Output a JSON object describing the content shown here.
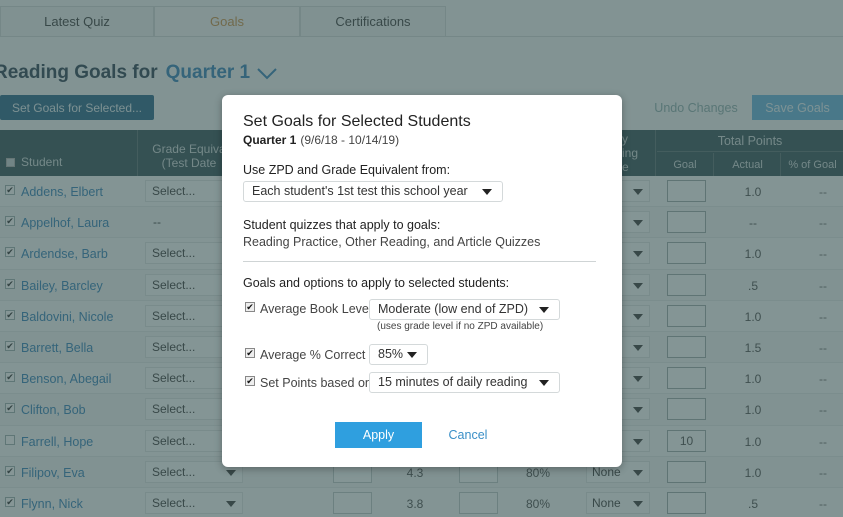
{
  "tabs": [
    {
      "label": "Latest Quiz",
      "active": false
    },
    {
      "label": "Goals",
      "active": true
    },
    {
      "label": "Certifications",
      "active": false
    }
  ],
  "header": {
    "title": "Reading Goals for",
    "period": "Quarter 1",
    "period_icon": "chevron-down-icon"
  },
  "toolbar": {
    "set_goals_label": "Set Goals for Selected...",
    "undo_label": "Undo Changes",
    "save_label": "Save Goals"
  },
  "table": {
    "headers": {
      "student": "Student",
      "grade_line1": "Grade Equiva",
      "grade_line2": "(Test Date",
      "reading_line1": "y",
      "reading_line2": "ing",
      "reading_line3": "e",
      "total_points": "Total Points",
      "goal": "Goal",
      "actual": "Actual",
      "pct_goal": "% of Goal"
    },
    "rows": [
      {
        "checked": true,
        "name": "Addens, Elbert",
        "grade": "Select...",
        "grade_is_select": true,
        "book_level": "",
        "pct_correct": "",
        "reading": "",
        "goal": "",
        "actual": "1.0",
        "pct_goal": "--"
      },
      {
        "checked": true,
        "name": "Appelhof, Laura",
        "grade": "--",
        "grade_is_select": false,
        "book_level": "",
        "pct_correct": "",
        "reading": "",
        "goal": "",
        "actual": "--",
        "pct_goal": "--"
      },
      {
        "checked": true,
        "name": "Ardendse, Barb",
        "grade": "Select...",
        "grade_is_select": true,
        "book_level": "",
        "pct_correct": "",
        "reading": "",
        "goal": "",
        "actual": "1.0",
        "pct_goal": "--"
      },
      {
        "checked": true,
        "name": "Bailey, Barcley",
        "grade": "Select...",
        "grade_is_select": true,
        "book_level": "",
        "pct_correct": "",
        "reading": "",
        "goal": "",
        "actual": ".5",
        "pct_goal": "--"
      },
      {
        "checked": true,
        "name": "Baldovini, Nicole",
        "grade": "Select...",
        "grade_is_select": true,
        "book_level": "",
        "pct_correct": "",
        "reading": "",
        "goal": "",
        "actual": "1.0",
        "pct_goal": "--"
      },
      {
        "checked": true,
        "name": "Barrett, Bella",
        "grade": "Select...",
        "grade_is_select": true,
        "book_level": "",
        "pct_correct": "",
        "reading": "",
        "goal": "",
        "actual": "1.5",
        "pct_goal": "--"
      },
      {
        "checked": true,
        "name": "Benson, Abegail",
        "grade": "Select...",
        "grade_is_select": true,
        "book_level": "",
        "pct_correct": "",
        "reading": "",
        "goal": "",
        "actual": "1.0",
        "pct_goal": "--"
      },
      {
        "checked": true,
        "name": "Clifton, Bob",
        "grade": "Select...",
        "grade_is_select": true,
        "book_level": "",
        "pct_correct": "",
        "reading": "",
        "goal": "",
        "actual": "1.0",
        "pct_goal": "--"
      },
      {
        "checked": false,
        "name": "Farrell, Hope",
        "grade": "Select...",
        "grade_is_select": true,
        "book_level": "",
        "pct_correct": "",
        "reading": "",
        "goal": "10",
        "actual": "1.0",
        "pct_goal": "--"
      },
      {
        "checked": true,
        "name": "Filipov, Eva",
        "grade": "Select...",
        "grade_is_select": true,
        "book_level": "4.3",
        "pct_correct": "80%",
        "reading": "None",
        "goal": "",
        "actual": "1.0",
        "pct_goal": "--"
      },
      {
        "checked": true,
        "name": "Flynn, Nick",
        "grade": "Select...",
        "grade_is_select": true,
        "book_level": "3.8",
        "pct_correct": "80%",
        "reading": "None",
        "goal": "",
        "actual": ".5",
        "pct_goal": "--"
      }
    ]
  },
  "modal": {
    "title": "Set Goals for Selected Students",
    "period": "Quarter 1",
    "dates": "(9/6/18 - 10/14/19)",
    "zpd_label": "Use ZPD and Grade Equivalent from:",
    "zpd_value": "Each student's 1st test this school year",
    "quizzes_label": "Student quizzes that apply to goals:",
    "quizzes_value": "Reading Practice, Other Reading, and Article Quizzes",
    "options_label": "Goals and options to apply to selected students:",
    "options": [
      {
        "checked": true,
        "label": "Average Book Level",
        "value": "Moderate (low end of ZPD)"
      },
      {
        "checked": true,
        "label": "Average % Correct",
        "value": "85%"
      },
      {
        "checked": true,
        "label": "Set Points based on",
        "value": "15 minutes of daily reading"
      }
    ],
    "book_level_note": "(uses grade level if no ZPD available)",
    "apply_label": "Apply",
    "cancel_label": "Cancel"
  },
  "colors": {
    "accent": "#2f9fdf",
    "link": "#2a7db5",
    "header_bg": "#2c4a4f",
    "active_tab": "#c98a3a",
    "primary_button": "#1f5f83"
  }
}
